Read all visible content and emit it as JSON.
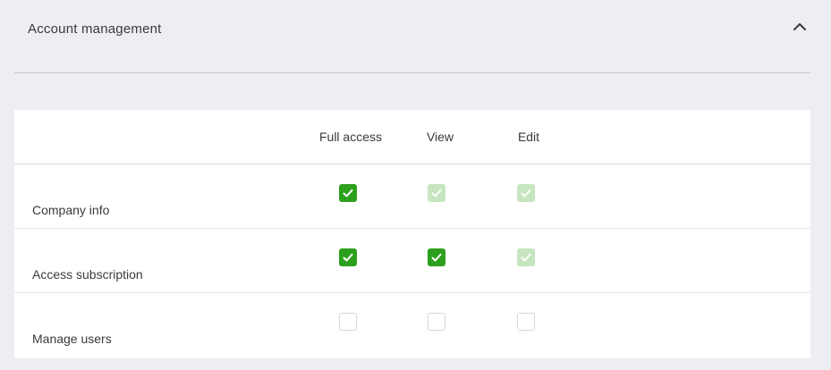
{
  "section": {
    "title": "Account management",
    "toggle_icon": "chevron-up-icon"
  },
  "columns": [
    "Full access",
    "View",
    "Edit"
  ],
  "rows": [
    {
      "label": "Company info",
      "full_access": "checked",
      "view": "checked-disabled",
      "edit": "checked-disabled"
    },
    {
      "label": "Access subscription",
      "full_access": "checked",
      "view": "checked",
      "edit": "checked-disabled"
    },
    {
      "label": "Manage users",
      "full_access": "unchecked",
      "view": "unchecked",
      "edit": "unchecked"
    }
  ],
  "colors": {
    "checkbox_checked": "#2ca01c",
    "checkbox_checked_disabled": "#c6e6c0",
    "background": "#eceef1"
  }
}
